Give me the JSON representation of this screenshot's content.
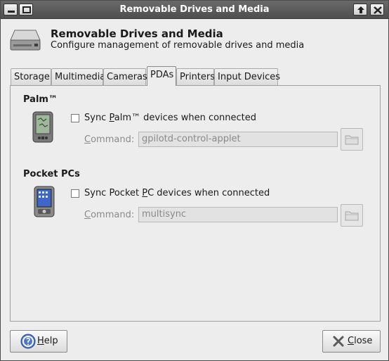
{
  "window": {
    "title": "Removable Drives and Media"
  },
  "header": {
    "title": "Removable Drives and Media",
    "subtitle": "Configure management of removable drives and media",
    "icon": "removable-drive-icon"
  },
  "tabs": [
    {
      "label": "Storage",
      "active": false
    },
    {
      "label": "Multimedia",
      "active": false
    },
    {
      "label": "Cameras",
      "active": false
    },
    {
      "label": "PDAs",
      "active": true
    },
    {
      "label": "Printers",
      "active": false
    },
    {
      "label": "Input Devices",
      "active": false
    }
  ],
  "palm": {
    "section_title": "Palm™",
    "checkbox_pre": "Sync ",
    "checkbox_mnemonic": "P",
    "checkbox_post": "alm™ devices when connected",
    "checked": false,
    "command_mnemonic": "C",
    "command_rest": "ommand:",
    "command_value": "gpilotd-control-applet"
  },
  "pocketpc": {
    "section_title": "Pocket PCs",
    "checkbox_pre": "Sync Pocket ",
    "checkbox_mnemonic": "P",
    "checkbox_post": "C devices when connected",
    "checked": false,
    "command_mnemonic": "C",
    "command_rest": "ommand:",
    "command_value": "multisync"
  },
  "buttons": {
    "help_mnemonic": "H",
    "help_rest": "elp",
    "close_mnemonic": "C",
    "close_rest": "lose"
  },
  "colors": {
    "titlebar": "#555555",
    "background": "#ededed",
    "disabled_text": "#8a8a8a"
  }
}
